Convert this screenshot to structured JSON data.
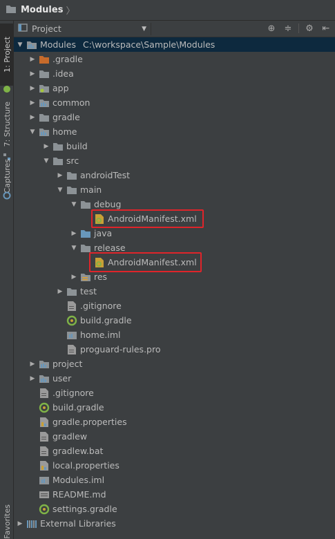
{
  "navbar": {
    "breadcrumb": "Modules"
  },
  "side_tabs": [
    {
      "label": "1: Project"
    },
    {
      "label": "7: Structure"
    },
    {
      "label": "Captures"
    },
    {
      "label": "Favorites"
    }
  ],
  "tool_window": {
    "view_selector": "Project"
  },
  "tree": {
    "root": {
      "label": "Modules",
      "path": "C:\\workspace\\Sample\\Modules"
    },
    "items": [
      {
        "label": ".gradle"
      },
      {
        "label": ".idea"
      },
      {
        "label": "app"
      },
      {
        "label": "common"
      },
      {
        "label": "gradle"
      },
      {
        "label": "home"
      },
      {
        "label": "build"
      },
      {
        "label": "src"
      },
      {
        "label": "androidTest"
      },
      {
        "label": "main"
      },
      {
        "label": "debug"
      },
      {
        "label": "AndroidManifest.xml"
      },
      {
        "label": "java"
      },
      {
        "label": "release"
      },
      {
        "label": "AndroidManifest.xml"
      },
      {
        "label": "res"
      },
      {
        "label": "test"
      },
      {
        "label": ".gitignore"
      },
      {
        "label": "build.gradle"
      },
      {
        "label": "home.iml"
      },
      {
        "label": "proguard-rules.pro"
      },
      {
        "label": "project"
      },
      {
        "label": "user"
      },
      {
        "label": ".gitignore"
      },
      {
        "label": "build.gradle"
      },
      {
        "label": "gradle.properties"
      },
      {
        "label": "gradlew"
      },
      {
        "label": "gradlew.bat"
      },
      {
        "label": "local.properties"
      },
      {
        "label": "Modules.iml"
      },
      {
        "label": "README.md"
      },
      {
        "label": "settings.gradle"
      },
      {
        "label": "External Libraries"
      }
    ]
  },
  "colors": {
    "background": "#3c3f41",
    "text": "#bbbbbb",
    "folder": "#8c9296",
    "gradle_folder": "#c76b2b",
    "highlight_box": "#e0242a",
    "selection": "#0d293e"
  }
}
